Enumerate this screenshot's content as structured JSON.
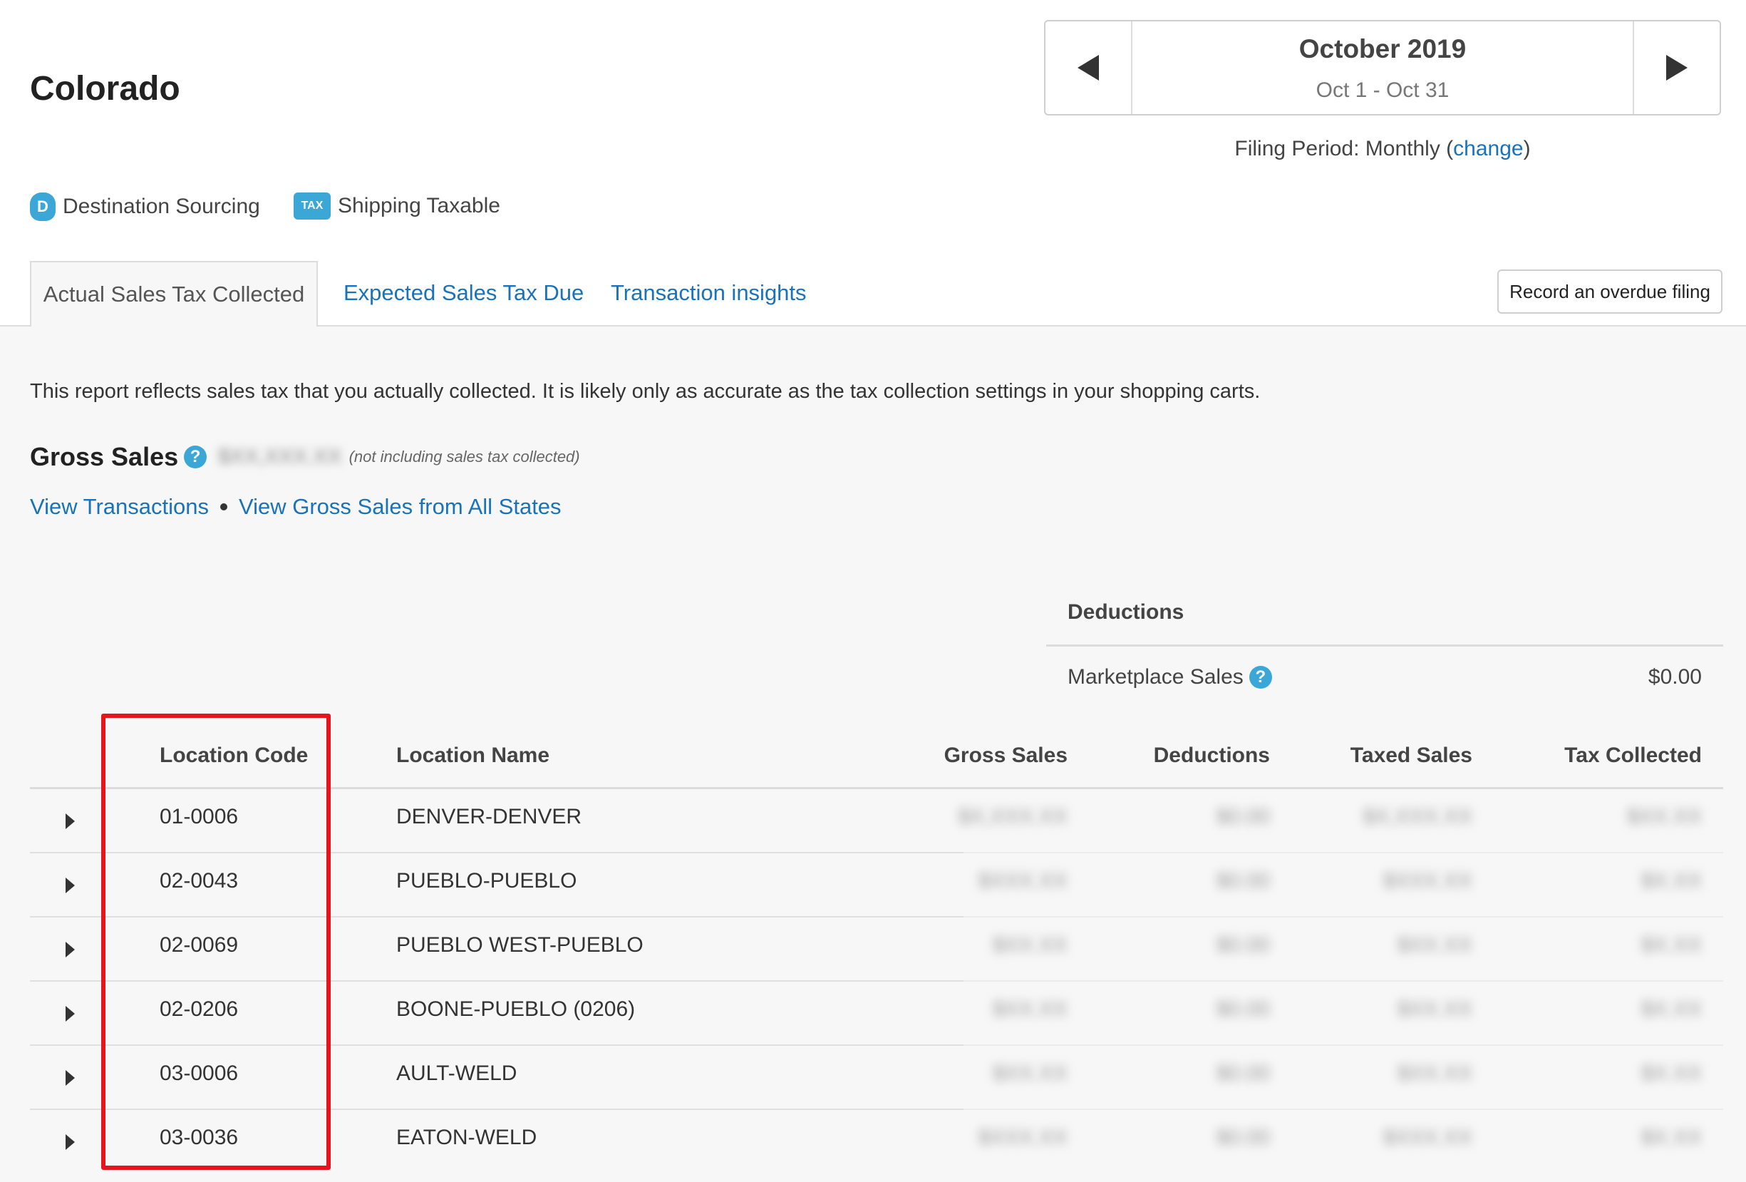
{
  "state_title": "Colorado",
  "period": {
    "month": "October 2019",
    "range": "Oct 1 - Oct 31",
    "filing_prefix": "Filing Period: Monthly (",
    "filing_change": "change",
    "filing_suffix": ")"
  },
  "badges": {
    "destination": {
      "icon": "money-bag-icon",
      "icon_text": "D",
      "label": "Destination Sourcing"
    },
    "shipping": {
      "icon": "tax-truck-icon",
      "icon_text": "TAX",
      "label": "Shipping Taxable"
    }
  },
  "tabs": [
    {
      "label": "Actual Sales Tax Collected",
      "active": true
    },
    {
      "label": "Expected Sales Tax Due",
      "active": false
    },
    {
      "label": "Transaction insights",
      "active": false
    }
  ],
  "overdue_button": "Record an overdue filing",
  "report_description": "This report reflects sales tax that you actually collected. It is likely only as accurate as the tax collection settings in your shopping carts.",
  "gross_sales": {
    "title": "Gross Sales",
    "value_redacted": "$XX,XXX.XX",
    "note": "(not including sales tax collected)"
  },
  "links": {
    "view_transactions": "View Transactions",
    "view_all_states": "View Gross Sales from All States"
  },
  "deductions_panel": {
    "title": "Deductions",
    "marketplace_label": "Marketplace Sales",
    "marketplace_value": "$0.00"
  },
  "table": {
    "headers": {
      "code": "Location Code",
      "name": "Location Name",
      "gross": "Gross Sales",
      "deductions": "Deductions",
      "taxed": "Taxed Sales",
      "collected": "Tax Collected"
    },
    "rows": [
      {
        "code": "01-0006",
        "name": "DENVER-DENVER",
        "gross": "$X,XXX.XX",
        "deductions": "$0.00",
        "taxed": "$X,XXX.XX",
        "collected": "$XX.XX"
      },
      {
        "code": "02-0043",
        "name": "PUEBLO-PUEBLO",
        "gross": "$XXX.XX",
        "deductions": "$0.00",
        "taxed": "$XXX.XX",
        "collected": "$X.XX"
      },
      {
        "code": "02-0069",
        "name": "PUEBLO WEST-PUEBLO",
        "gross": "$XX.XX",
        "deductions": "$0.00",
        "taxed": "$XX.XX",
        "collected": "$X.XX"
      },
      {
        "code": "02-0206",
        "name": "BOONE-PUEBLO (0206)",
        "gross": "$XX.XX",
        "deductions": "$0.00",
        "taxed": "$XX.XX",
        "collected": "$X.XX"
      },
      {
        "code": "03-0006",
        "name": "AULT-WELD",
        "gross": "$XX.XX",
        "deductions": "$0.00",
        "taxed": "$XX.XX",
        "collected": "$X.XX"
      },
      {
        "code": "03-0036",
        "name": "EATON-WELD",
        "gross": "$XXX.XX",
        "deductions": "$0.00",
        "taxed": "$XXX.XX",
        "collected": "$X.XX"
      }
    ]
  },
  "colors": {
    "link": "#1a73b8",
    "accent_icon": "#3ba7d6",
    "highlight": "#e8141c"
  }
}
